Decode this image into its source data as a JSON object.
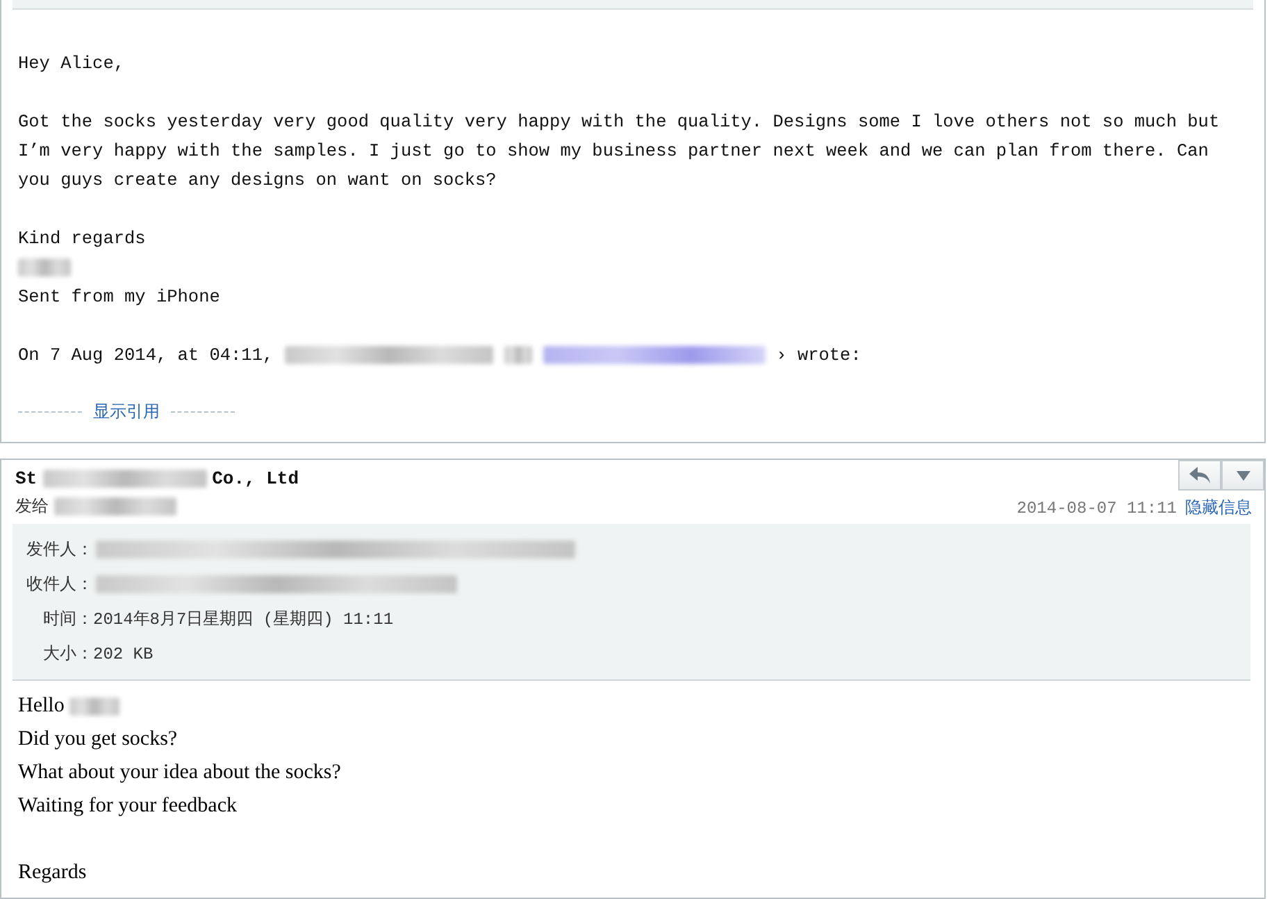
{
  "quoted_message": {
    "greeting": "Hey Alice,",
    "paragraphs": [
      "Got the socks yesterday very good quality very happy with the quality. Designs some I love others not so much but I’m very happy with the samples. I just go to show my business partner next week and we can plan from there. Can you guys create any designs on want on socks?"
    ],
    "signoff": "Kind regards",
    "signoff_name_redacted": true,
    "signature": "Sent from my iPhone",
    "quote_header": {
      "prefix": "On 7 Aug 2014, at 04:11,",
      "redacted": true,
      "suffix": "› wrote:"
    },
    "show_quote_link": "显示引用"
  },
  "message": {
    "sender_start": "St",
    "sender_redacted": true,
    "sender_end": "Co., Ltd",
    "to_label": "发给",
    "to_redacted": true,
    "date": "2014-08-07 11:11",
    "hide_details_link": "隐藏信息",
    "details": [
      {
        "label": "发件人：",
        "redacted": true
      },
      {
        "label": "收件人：",
        "redacted": true
      },
      {
        "label": "时间：",
        "value": "2014年8月7日星期四 (星期四) 11:11",
        "redacted": false
      },
      {
        "label": "大小：",
        "value": "202 KB",
        "redacted": false
      }
    ],
    "body": [
      {
        "text": "Hello",
        "redacted": true
      },
      {
        "text": "Did you get socks?",
        "redacted": false
      },
      {
        "text": "What about your idea about the socks?",
        "redacted": false
      },
      {
        "text": "Waiting for your feedback",
        "redacted": false
      },
      {
        "redacted": false
      },
      {
        "text": "Regards",
        "redacted": false
      }
    ]
  }
}
